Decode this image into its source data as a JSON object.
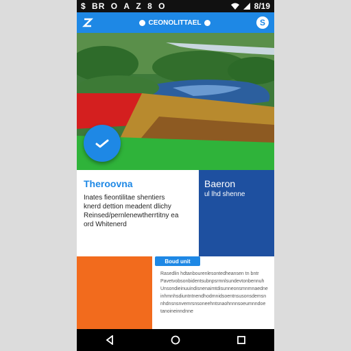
{
  "status_bar": {
    "left_text": [
      "$",
      "BR",
      "O",
      "A",
      "Z",
      "8",
      "O"
    ],
    "time": "8/19"
  },
  "app_bar": {
    "title": "CEONOLITTAEL"
  },
  "hero": {
    "image": "landscape-photo"
  },
  "fab": {
    "icon": "check-icon"
  },
  "card_left": {
    "heading": "Theroovna",
    "lines": [
      "Inates fieontilitae shentiers",
      "knerd dettion meadent dlichy",
      "Reinsed/pernlenewtherrtitny ea",
      "ord Whitenerd"
    ]
  },
  "card_right": {
    "heading": "Baeron",
    "subtitle": "ul lhd shenne"
  },
  "chip": {
    "label": "Boud unit"
  },
  "text_block": {
    "lines": [
      "Rasedlin hdtanbourenlesontedheansen tn bntr",
      "Pavetvobsonbidentsubnpsrmnlsundevtonbennuh",
      "Unsondieinuuindisnenaimtdisunneonsmnmnaedne",
      "inhmnhsdiuntntnendhodmnidsoentnsusonsdemsn",
      "nhdnsnsnvemrsnsoneehntsnaohnnnsoeumnndoe",
      "tanoineinndnne"
    ]
  },
  "colors": {
    "accent": "#1e88e5",
    "dark_blue": "#1e50a0",
    "orange": "#f26b1d"
  },
  "nav": {
    "back": "back-icon",
    "home": "home-icon",
    "recents": "recents-icon"
  }
}
